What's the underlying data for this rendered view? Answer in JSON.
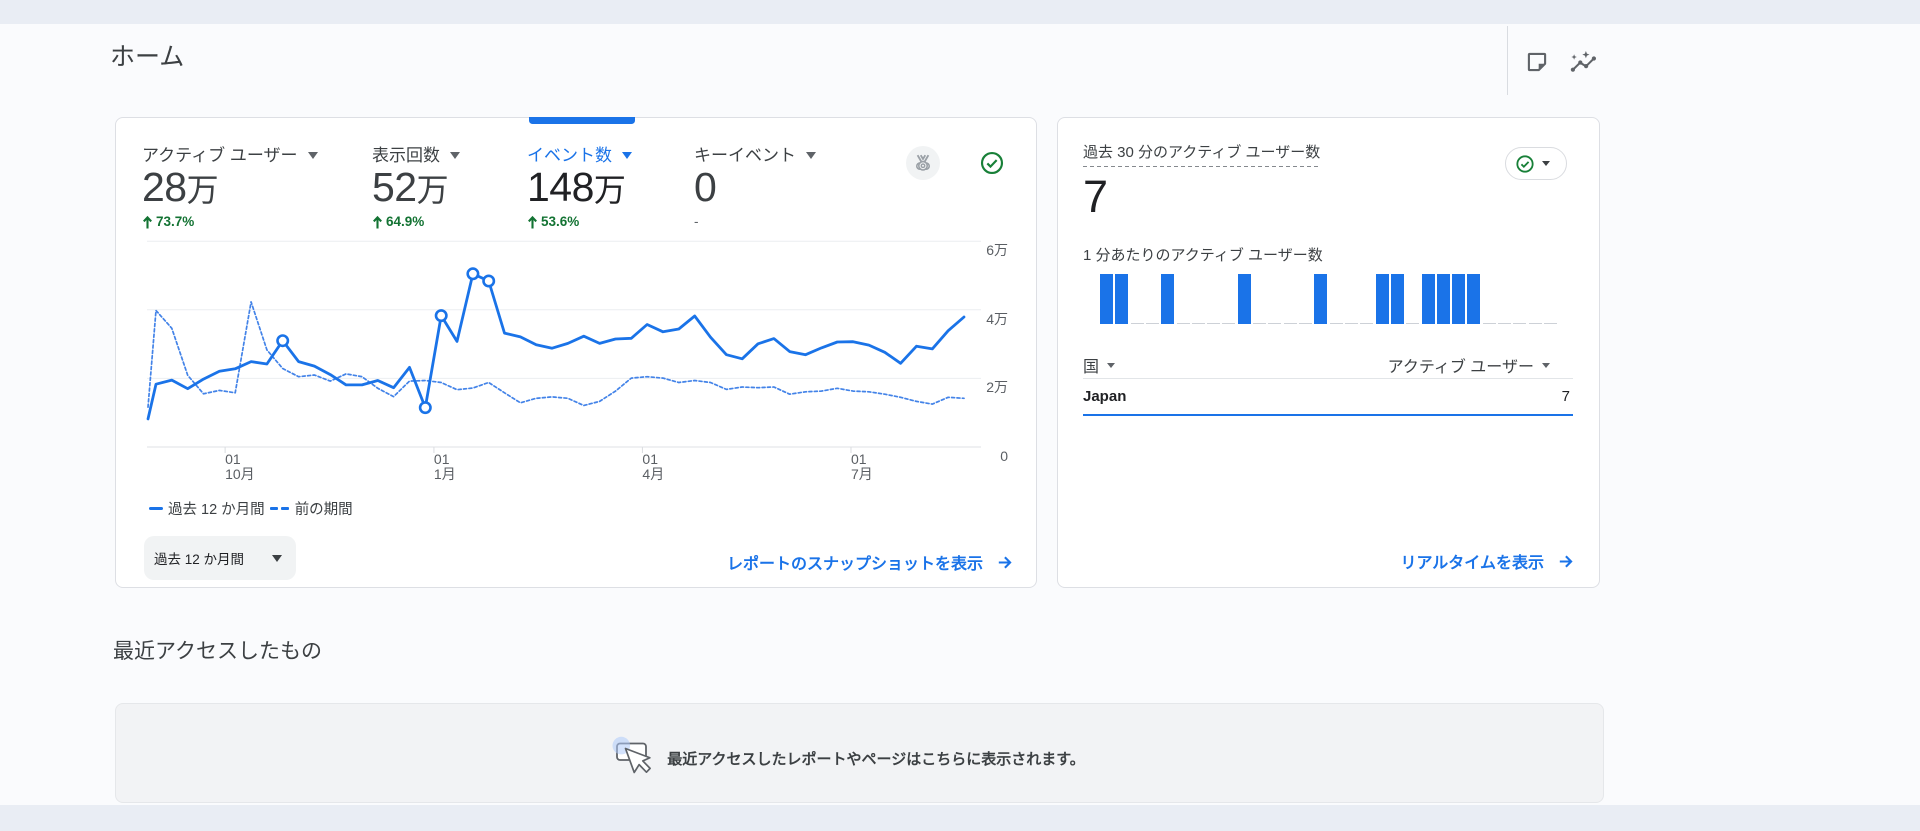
{
  "page": {
    "title": "ホーム"
  },
  "header": {
    "icons": [
      {
        "name": "note-icon"
      },
      {
        "name": "insights-icon"
      }
    ]
  },
  "accent": "#1a73e8",
  "green": "#137333",
  "scorecard": {
    "metrics": [
      {
        "label": "アクティブ ユーザー",
        "value": "28万",
        "delta": "↑ 73.7%",
        "selected": false
      },
      {
        "label": "表示回数",
        "value": "52万",
        "delta": "↑ 64.9%",
        "selected": false
      },
      {
        "label": "イベント数",
        "value": "148万",
        "delta": "↑ 53.6%",
        "selected": true
      },
      {
        "label": "キーイベント",
        "value": "0",
        "delta": "-",
        "selected": false,
        "no_data": true
      }
    ],
    "legend": [
      {
        "label": "過去 12 か月間",
        "style": "solid"
      },
      {
        "label": "前の期間",
        "style": "dashed"
      }
    ],
    "range_button": "過去 12 か月間",
    "snapshot_link": "レポートのスナップショットを表示"
  },
  "chart_data": {
    "type": "line",
    "unit": "万",
    "ylim": [
      0,
      6
    ],
    "yticks": [
      {
        "v": 6,
        "label": "6万"
      },
      {
        "v": 4,
        "label": "4万"
      },
      {
        "v": 2,
        "label": "2万"
      },
      {
        "v": 0,
        "label": "0"
      }
    ],
    "xticks": [
      {
        "frac": 0.0945,
        "line1": "01",
        "line2": "10月"
      },
      {
        "frac": 0.3504,
        "line1": "01",
        "line2": "1月"
      },
      {
        "frac": 0.6059,
        "line1": "01",
        "line2": "4月"
      },
      {
        "frac": 0.8615,
        "line1": "01",
        "line2": "7月"
      }
    ],
    "series": [
      {
        "name": "過去 12 か月間",
        "style": "solid",
        "values": [
          0.82,
          1.83,
          1.95,
          1.7,
          1.98,
          2.21,
          2.28,
          2.49,
          2.42,
          3.1,
          2.49,
          2.36,
          2.11,
          1.81,
          1.81,
          1.94,
          1.73,
          2.32,
          1.15,
          3.83,
          3.08,
          5.05,
          4.84,
          3.32,
          3.21,
          2.98,
          2.88,
          3.02,
          3.23,
          3.02,
          3.15,
          3.17,
          3.57,
          3.36,
          3.44,
          3.82,
          3.2,
          2.69,
          2.57,
          3.01,
          3.16,
          2.78,
          2.69,
          2.89,
          3.06,
          3.07,
          2.97,
          2.76,
          2.44,
          2.94,
          2.86,
          3.39,
          3.79
        ],
        "markers": [
          9,
          18,
          19,
          21,
          22
        ]
      },
      {
        "name": "前の期間",
        "style": "dashed",
        "values": [
          1.16,
          3.98,
          3.46,
          2.09,
          1.55,
          1.65,
          1.58,
          4.23,
          2.83,
          2.29,
          2.05,
          2.1,
          1.92,
          2.13,
          2.05,
          1.71,
          1.47,
          1.92,
          1.94,
          1.88,
          1.67,
          1.72,
          1.88,
          1.58,
          1.29,
          1.42,
          1.46,
          1.42,
          1.21,
          1.33,
          1.63,
          2.01,
          2.05,
          2.01,
          1.88,
          1.94,
          1.88,
          1.68,
          1.75,
          1.73,
          1.75,
          1.54,
          1.61,
          1.63,
          1.71,
          1.63,
          1.61,
          1.54,
          1.45,
          1.33,
          1.25,
          1.45,
          1.42
        ],
        "markers": []
      }
    ]
  },
  "realtime": {
    "title": "過去 30 分のアクティブ ユーザー数",
    "count": "7",
    "minute_label": "1 分あたりのアクティブ ユーザー数",
    "bars_data": {
      "type": "bar",
      "slot_count": 30,
      "active_slots": [
        0,
        1,
        4,
        9,
        14,
        18,
        19,
        21,
        22,
        23,
        24
      ]
    },
    "table": {
      "columns": [
        "国",
        "アクティブ ユーザー"
      ],
      "rows": [
        {
          "country": "Japan",
          "users": "7"
        }
      ]
    },
    "link": "リアルタイムを表示"
  },
  "recent": {
    "heading": "最近アクセスしたもの",
    "empty_message": "最近アクセスしたレポートやページはこちらに表示されます。"
  }
}
